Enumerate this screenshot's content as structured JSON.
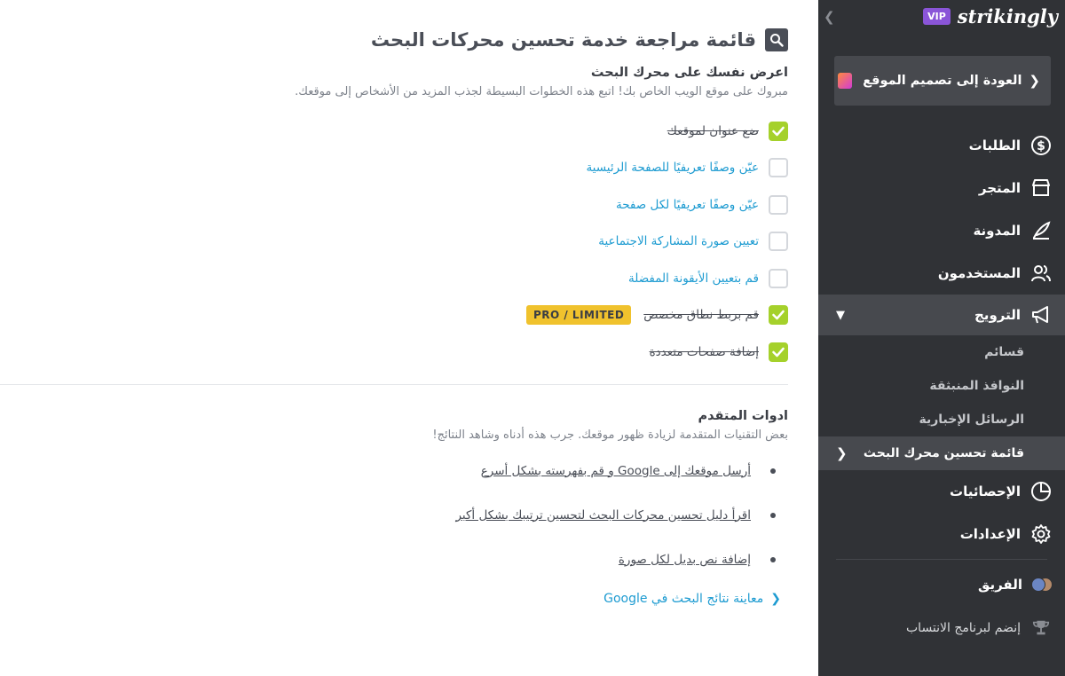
{
  "main": {
    "page_title": "قائمة مراجعة خدمة تحسين محركات البحث",
    "section": {
      "heading": "اعرض نفسك على محرك البحث",
      "subtitle": "مبروك على موقع الويب الخاص بك! اتبع هذه الخطوات البسيطة لجذب المزيد من الأشخاص إلى موقعك."
    },
    "checklist": [
      {
        "label": "ضع عنوان لموقعك",
        "checked": true
      },
      {
        "label": "عيّن وصفًا تعريفيًا للصفحة الرئيسية",
        "checked": false
      },
      {
        "label": "عيّن وصفًا تعريفيًا لكل صفحة",
        "checked": false
      },
      {
        "label": "تعيين صورة المشاركة الاجتماعية",
        "checked": false
      },
      {
        "label": "قم بتعيين الأيقونة المفضلة",
        "checked": false
      },
      {
        "label": "قم بربط نطاق مخصص",
        "checked": true,
        "badge": "PRO / LIMITED"
      },
      {
        "label": "إضافة صفحات متعددة",
        "checked": true
      }
    ],
    "advanced": {
      "heading": "ادوات المتقدم",
      "subtitle": "بعض التقنيات المتقدمة لزيادة ظهور موقعك. جرب هذه أدناه وشاهد النتائج!",
      "links": [
        "أرسل موقعك إلى Google و قم بفهرسته بشكل أسرع",
        "اقرأ دليل تحسين محركات البحث لتحسين ترتيبك بشكل أكبر",
        "إضافة نص بديل لكل صورة"
      ],
      "google_preview": "معاينة نتائج البحث في Google"
    }
  },
  "sidebar": {
    "logo": "strikingly",
    "vip": "VIP",
    "back_button": "العودة إلى تصميم الموقع",
    "items": [
      {
        "label": "الطلبات",
        "icon": "dollar-circle-icon"
      },
      {
        "label": "المتجر",
        "icon": "store-icon"
      },
      {
        "label": "المدونة",
        "icon": "quill-icon"
      },
      {
        "label": "المستخدمون",
        "icon": "users-icon"
      }
    ],
    "promotion": {
      "label": "الترويج",
      "icon": "megaphone-icon",
      "sub_items": [
        "قسائم",
        "النوافذ المنبثقة",
        "الرسائل الإخبارية",
        "قائمة تحسين محرك البحث"
      ]
    },
    "items_after": [
      {
        "label": "الإحصائيات",
        "icon": "pie-chart-icon"
      },
      {
        "label": "الإعدادات",
        "icon": "gear-icon"
      }
    ],
    "team": "الفريق",
    "join": "إنضم لبرنامج الانتساب"
  },
  "colors": {
    "sidebar_bg": "#303236",
    "active_bg": "#47494e",
    "accent_green": "#a5d12b",
    "link_blue": "#1d9bd1",
    "badge_yellow": "#f0c22d",
    "vip_purple": "#8a55d8"
  }
}
